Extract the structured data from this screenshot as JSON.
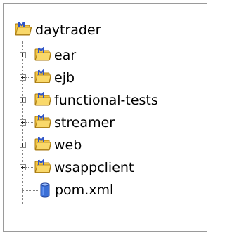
{
  "tree": {
    "root": {
      "label": "daytrader",
      "icon": "maven-project-icon"
    },
    "children": [
      {
        "label": "ear",
        "icon": "maven-project-icon",
        "expandable": true
      },
      {
        "label": "ejb",
        "icon": "maven-project-icon",
        "expandable": true
      },
      {
        "label": "functional-tests",
        "icon": "maven-project-icon",
        "expandable": true
      },
      {
        "label": "streamer",
        "icon": "maven-project-icon",
        "expandable": true
      },
      {
        "label": "web",
        "icon": "maven-project-icon",
        "expandable": true
      },
      {
        "label": "wsappclient",
        "icon": "maven-project-icon",
        "expandable": true
      },
      {
        "label": "pom.xml",
        "icon": "xml-file-icon",
        "expandable": false
      }
    ]
  },
  "colors": {
    "folder_yellow": "#f2c230",
    "maven_blue": "#2f55c8",
    "file_blue": "#4a78d8",
    "border": "#9a9a9a"
  }
}
